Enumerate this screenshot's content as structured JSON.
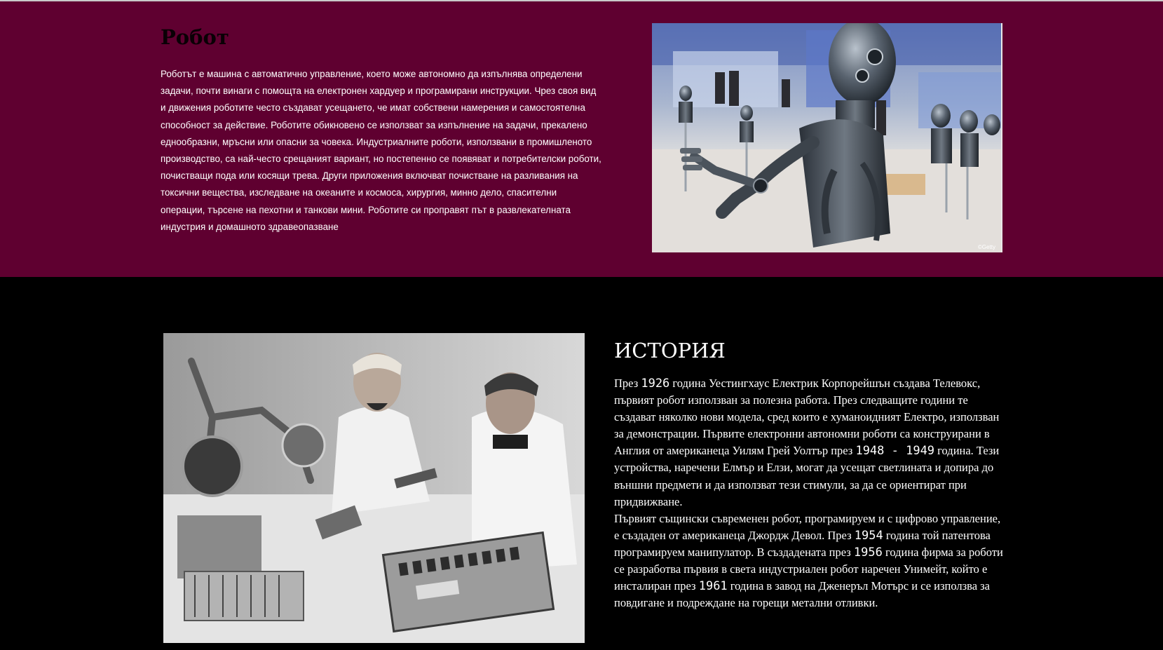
{
  "about": {
    "title": "Робот",
    "text": "Роботът е машина с автоматично управление, което може автономно да изпълнява определени задачи, почти винаги с помощта на електронен хардуер и програмирани инструкции. Чрез своя вид и движения роботите често създават усещането, че имат собствени намерения и самостоятелна способност за действие. Роботите обикновено се използват за изпълнение на задачи, прекалено еднообразни, мръсни или опасни за човека. Индустриалните роботи, използвани в промишленото производство, са най-често срещаният вариант, но постепенно се появяват и потребителски роботи, почистващи пода или косящи трева. Други приложения включват почистване на разливания на токсични вещества, изследване на океаните и космоса, хирургия, минно дело, спасителни операции, търсене на пехотни и танкови мини. Роботите си проправят път в развлекателната индустрия и домашното здравеопазване",
    "image_watermark": "©Getty"
  },
  "history": {
    "title": "ИСТОРИЯ",
    "p1": {
      "t1": "През ",
      "n1": "1926",
      "t2": " година Уестингхаус Електрик Корпорейшън създава Телевокс, първият робот използван за полезна работа. През следващите години те създават няколко нови модела, сред които е хуманоидният Електро, използван за демонстрации. Първите електронни автономни роботи са конструирани в Англия от американеца Уилям Грей Уолтър през ",
      "n2": "1948 - 1949",
      "t3": " година. Тези устройства, наречени Елмър и Елзи, могат да усещат светлината и допира до външни предмети и да използват тези стимули, за да се ориентират при придвижване."
    },
    "p2": {
      "t1": "Първият същински съвременен робот, програмируем и с цифрово управление, е създаден от американеца Джордж Девол. През ",
      "n1": "1954",
      "t2": " година той патентова програмируем манипулатор. В създадената през ",
      "n2": "1956",
      "t3": " година фирма за роботи се разработва първия в света индустриален робот наречен Унимейт, който е инсталиран през ",
      "n3": "1961",
      "t4": " година в завод на Дженеръл Мотърс и се използва за повдигане и подреждане на горещи метални отливки."
    }
  },
  "colors": {
    "about_bg": "#5f0030",
    "history_bg": "#000000",
    "text": "#ffffff"
  }
}
